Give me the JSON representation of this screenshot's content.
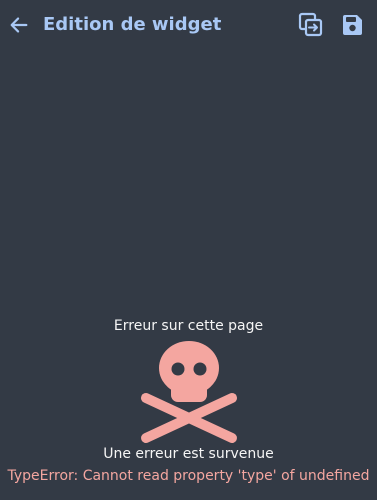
{
  "appbar": {
    "title": "Edition de widget",
    "back_icon": "arrow-left-icon",
    "copy_icon": "copy-icon",
    "save_icon": "floppy-disk-icon",
    "accent_color": "#a9c8f5"
  },
  "error": {
    "heading": "Erreur sur cette page",
    "icon": "skull-crossbones-icon",
    "icon_color": "#f4a6a0",
    "message": "Une erreur est survenue",
    "detail": "TypeError: Cannot read property 'type' of undefined",
    "detail_color": "#f4a6a0"
  },
  "colors": {
    "background": "#333a45",
    "text": "#f5f5f5"
  }
}
